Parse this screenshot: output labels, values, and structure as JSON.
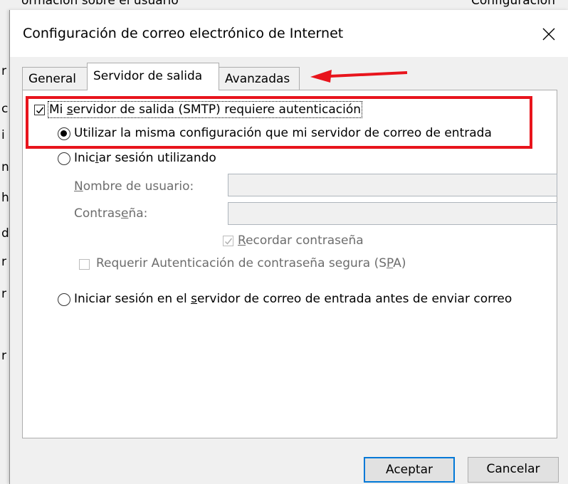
{
  "background": {
    "top_left_text": "ormacion sobre el usuario",
    "top_right_text": "Configuracion",
    "left_edge_chars": [
      "r",
      "c",
      "i",
      "n",
      "h",
      "d",
      "r",
      "r",
      "r"
    ]
  },
  "dialog": {
    "title": "Configuración de correo electrónico de Internet",
    "close_glyph": "✕",
    "tabs": [
      {
        "label": "General",
        "active": false
      },
      {
        "label": "Servidor de salida",
        "active": true
      },
      {
        "label": "Avanzadas",
        "active": false
      }
    ],
    "smtp_auth": {
      "label_pre": "Mi ",
      "label_u": "s",
      "label_post": "ervidor de salida (SMTP) requiere autenticación",
      "checked": true
    },
    "option_same": {
      "label": "Utilizar la misma configuración que mi servidor de correo de entrada",
      "selected": true
    },
    "option_login": {
      "label_pre": "Inic",
      "label_u": "i",
      "label_post": "ar sesión utilizando",
      "selected": false
    },
    "username": {
      "label_pre": "",
      "label_u": "N",
      "label_post": "ombre de usuario:",
      "value": ""
    },
    "password": {
      "label_pre": "Contras",
      "label_u": "e",
      "label_post": "ña:",
      "value": ""
    },
    "remember": {
      "label_pre": "",
      "label_u": "R",
      "label_post": "ecordar contraseña",
      "checked": true
    },
    "spa": {
      "label_pre": "Requerir Autenticación de contraseña segura (S",
      "label_u": "P",
      "label_post": "A)",
      "checked": false
    },
    "option_before_send": {
      "label_pre": "Iniciar sesión en el ",
      "label_u": "s",
      "label_post": "ervidor de correo de entrada antes de enviar correo",
      "selected": false
    },
    "buttons": {
      "ok": "Aceptar",
      "cancel": "Cancelar"
    }
  },
  "annotation_color": "#e8141c",
  "accent_color": "#0078d7"
}
